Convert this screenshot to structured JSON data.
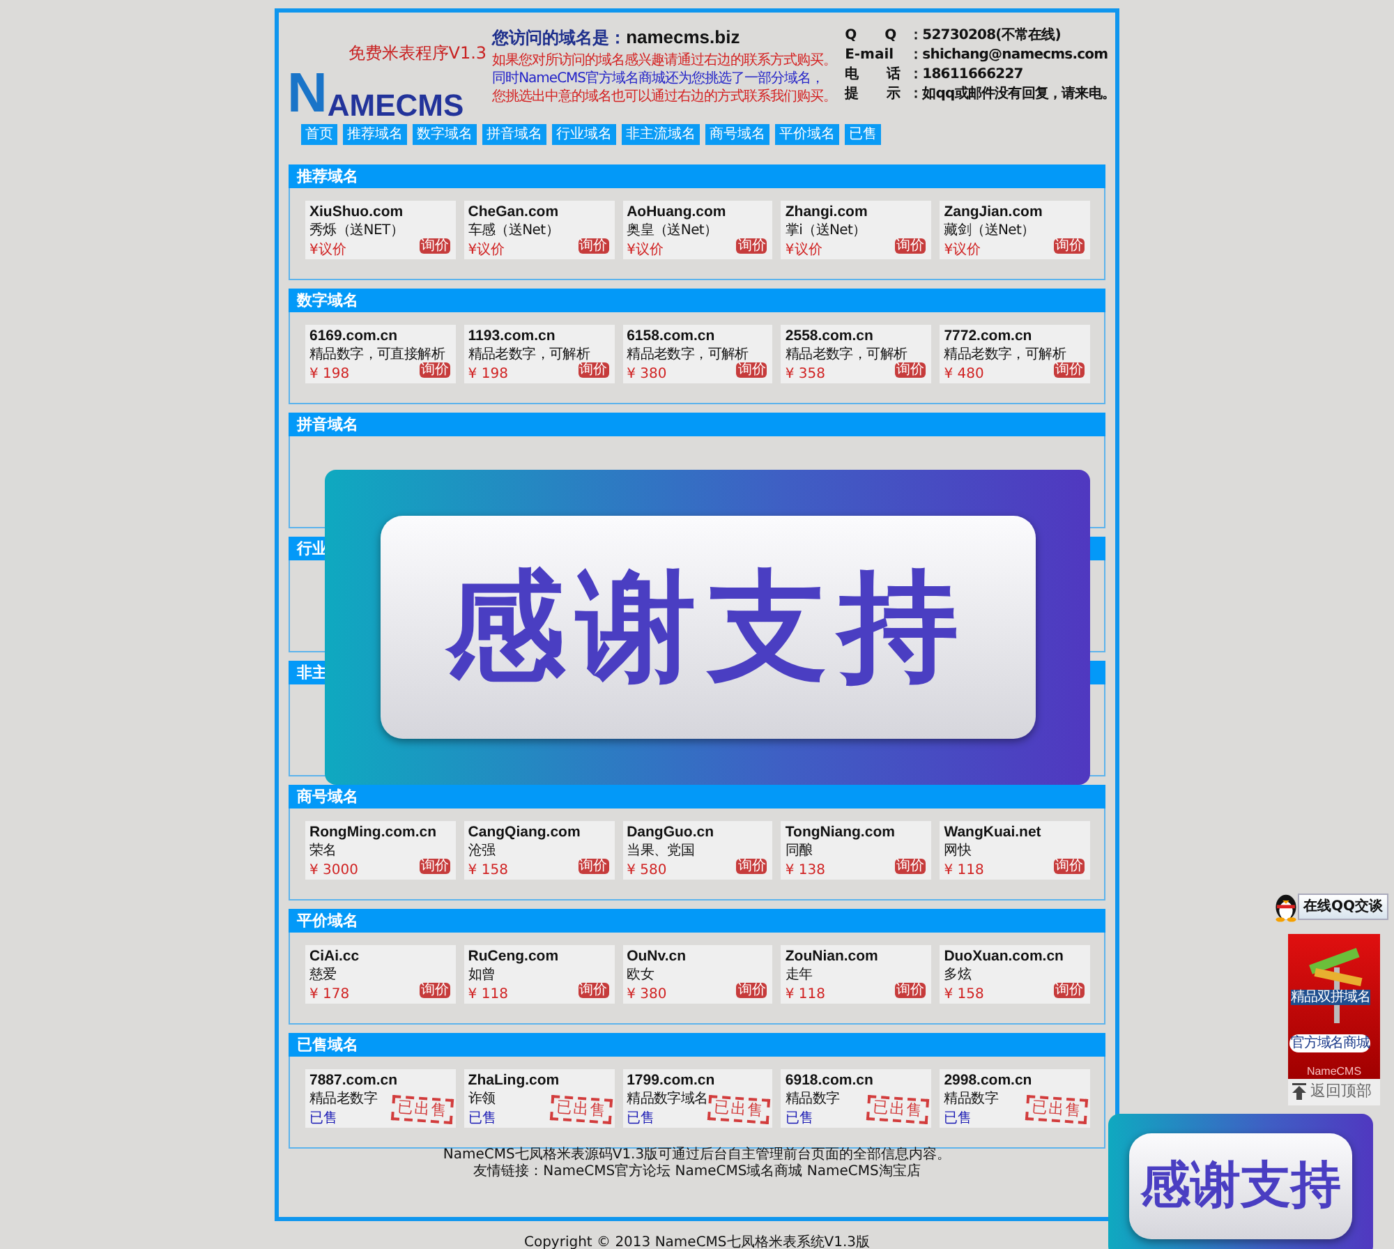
{
  "logo": {
    "initial": "N",
    "wordmark": "AMECMS",
    "tagline": "免费米表程序V1.3"
  },
  "info": {
    "heading": "您访问的域名是：",
    "domain": "namecms.biz",
    "lines": [
      {
        "text": "如果您对所访问的域名感兴趣请通过右边的联系方式购买。",
        "color": "#d42020"
      },
      {
        "text": "同时NameCMS官方域名商城还为您挑选了一部分域名，",
        "color": "#2424c8"
      },
      {
        "text": "您挑选出中意的域名也可以通过右边的方式联系我们购买。",
        "color": "#d42020"
      }
    ]
  },
  "contact": [
    {
      "label": "Q　　Q",
      "value": "：52730208(不常在线)"
    },
    {
      "label": "E-mail",
      "value": "：shichang@namecms.com"
    },
    {
      "label": "电　　话",
      "value": "：18611666227"
    },
    {
      "label": "提　　示",
      "value": "：如qq或邮件没有回复，请来电。"
    }
  ],
  "nav": [
    "首页",
    "推荐域名",
    "数字域名",
    "拼音域名",
    "行业域名",
    "非主流域名",
    "商号域名",
    "平价域名",
    "已售"
  ],
  "sections": [
    {
      "title": "推荐域名",
      "cards": [
        {
          "name": "XiuShuo.com",
          "desc": "秀烁（送NET）",
          "price": "¥议价",
          "tag": "询价",
          "sold": false
        },
        {
          "name": "CheGan.com",
          "desc": "车感（送Net）",
          "price": "¥议价",
          "tag": "询价",
          "sold": false
        },
        {
          "name": "AoHuang.com",
          "desc": "奥皇（送Net）",
          "price": "¥议价",
          "tag": "询价",
          "sold": false
        },
        {
          "name": "Zhangi.com",
          "desc": "掌i（送Net）",
          "price": "¥议价",
          "tag": "询价",
          "sold": false
        },
        {
          "name": "ZangJian.com",
          "desc": "藏剑（送Net）",
          "price": "¥议价",
          "tag": "询价",
          "sold": false
        }
      ]
    },
    {
      "title": "数字域名",
      "cards": [
        {
          "name": "6169.com.cn",
          "desc": "精品数字，可直接解析",
          "price": "¥ 198",
          "tag": "询价",
          "sold": false
        },
        {
          "name": "1193.com.cn",
          "desc": "精品老数字，可解析",
          "price": "¥ 198",
          "tag": "询价",
          "sold": false
        },
        {
          "name": "6158.com.cn",
          "desc": "精品老数字，可解析",
          "price": "¥ 380",
          "tag": "询价",
          "sold": false
        },
        {
          "name": "2558.com.cn",
          "desc": "精品老数字，可解析",
          "price": "¥ 358",
          "tag": "询价",
          "sold": false
        },
        {
          "name": "7772.com.cn",
          "desc": "精品老数字，可解析",
          "price": "¥ 480",
          "tag": "询价",
          "sold": false
        }
      ]
    },
    {
      "title": "拼音域名"
    },
    {
      "title": "行业"
    },
    {
      "title": "非主"
    },
    {
      "title": "商号域名",
      "cards": [
        {
          "name": "RongMing.com.cn",
          "desc": "荣名",
          "price": "¥ 3000",
          "tag": "询价",
          "sold": false
        },
        {
          "name": "CangQiang.com",
          "desc": "沧强",
          "price": "¥ 158",
          "tag": "询价",
          "sold": false
        },
        {
          "name": "DangGuo.cn",
          "desc": "当果、党国",
          "price": "¥ 580",
          "tag": "询价",
          "sold": false
        },
        {
          "name": "TongNiang.com",
          "desc": "同酿",
          "price": "¥ 138",
          "tag": "询价",
          "sold": false
        },
        {
          "name": "WangKuai.net",
          "desc": "网快",
          "price": "¥ 118",
          "tag": "询价",
          "sold": false
        }
      ]
    },
    {
      "title": "平价域名",
      "cards": [
        {
          "name": "CiAi.cc",
          "desc": "慈爱",
          "price": "¥ 178",
          "tag": "询价",
          "sold": false
        },
        {
          "name": "RuCeng.com",
          "desc": "如曾",
          "price": "¥ 118",
          "tag": "询价",
          "sold": false
        },
        {
          "name": "OuNv.cn",
          "desc": "欧女",
          "price": "¥ 380",
          "tag": "询价",
          "sold": false
        },
        {
          "name": "ZouNian.com",
          "desc": "走年",
          "price": "¥ 118",
          "tag": "询价",
          "sold": false
        },
        {
          "name": "DuoXuan.com.cn",
          "desc": "多炫",
          "price": "¥ 158",
          "tag": "询价",
          "sold": false
        }
      ]
    },
    {
      "title": "已售域名",
      "cards": [
        {
          "name": "7887.com.cn",
          "desc": "精品老数字",
          "price": "已售",
          "stamp": "已出售",
          "sold": true
        },
        {
          "name": "ZhaLing.com",
          "desc": "诈领",
          "price": "已售",
          "stamp": "已出售",
          "sold": true
        },
        {
          "name": "1799.com.cn",
          "desc": "精品数字域名",
          "price": "已售",
          "stamp": "已出售",
          "sold": true
        },
        {
          "name": "6918.com.cn",
          "desc": "精品数字",
          "price": "已售",
          "stamp": "已出售",
          "sold": true
        },
        {
          "name": "2998.com.cn",
          "desc": "精品数字",
          "price": "已售",
          "stamp": "已出售",
          "sold": true
        }
      ]
    }
  ],
  "footer": {
    "note": "NameCMS七凤格米表源码V1.3版可通过后台自主管理前台页面的全部信息内容。",
    "links_label": "友情链接：",
    "links": [
      "NameCMS官方论坛",
      "NameCMS域名商城",
      "NameCMS淘宝店"
    ],
    "copyright": "Copyright © 2013 NameCMS七凤格米表系统V1.3版"
  },
  "side": {
    "qq_button": "在线QQ交谈",
    "ad": {
      "sign": "精品双拼域名",
      "button": "官方域名商城",
      "brand": "NameCMS"
    },
    "back_to_top": "返回顶部"
  },
  "overlays": [
    {
      "text": "感谢支持"
    },
    {
      "text": "感谢支持"
    }
  ]
}
